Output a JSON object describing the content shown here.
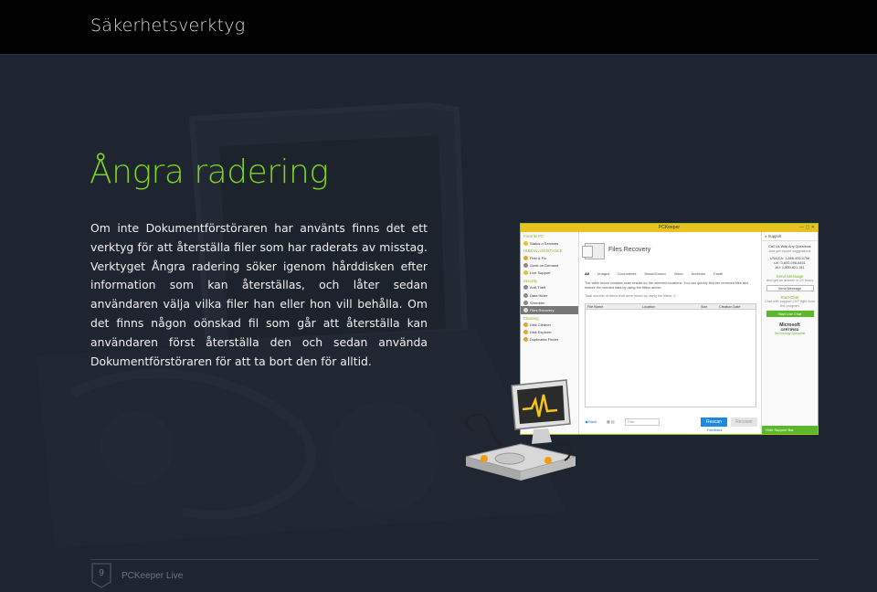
{
  "header": {
    "title": "Säkerhetsverktyg"
  },
  "content": {
    "heading": "Ångra radering",
    "paragraph": "Om inte Dokumentförstöraren har använts finns det ett verktyg för att återställa filer som har raderats av misstag. Verktyget Ångra radering söker igenom hårddisken efter information som kan återställas, och låter sedan användaren välja vilka filer han eller hon vill behålla. Om det finns någon oönskad fil som går att återställa kan användaren först återställa den och sedan använda Dokumentförstöraren för att ta bort den för alltid."
  },
  "screenshot": {
    "window_title": "PCKeeper",
    "left_panel": {
      "favorite": "Favorite PC",
      "status": "Status n Services",
      "human_section": "HUMAN ASSISTANCE",
      "items_human": [
        "Find & Fix",
        "Geek on Demand",
        "Live Support"
      ],
      "security_section": "Security",
      "items_security": [
        "Anti-Theft",
        "Data Hider",
        "Shredder",
        "Files Recovery"
      ],
      "cleaning_section": "Cleaning",
      "items_cleaning": [
        "Disk Cleaner",
        "Disk Explorer",
        "Duplicates Finder"
      ]
    },
    "main": {
      "title": "Files Recovery",
      "tabs": [
        "All",
        "Images",
        "Documents",
        "Music/Sound",
        "Video",
        "Archives",
        "Email"
      ],
      "description": "The table below contains scan results for the selected locations. You can quickly find the removed files and restore the needed data by using the filters above.",
      "count_label": "Total number of items that were found by using the filters:",
      "count_value": "0",
      "columns": [
        "File Name",
        "Location",
        "Size",
        "Creation Date"
      ],
      "back": "Back",
      "filter_placeholder": "Filter",
      "rescan": "Rescan",
      "recover": "Recover",
      "feedback": "Feedback"
    },
    "right_panel": {
      "support": "Support",
      "call": "Call Us With Any Questions",
      "call_sub": "And get expert suggestions",
      "phones": [
        "USA/CA: 1-866-400-4758",
        "UK: 0-800-098-8451",
        "AU: 1-800-821-311"
      ],
      "send_title": "Send Message",
      "send_sub": "And get an answer in 24 hours",
      "send_button": "Send Message",
      "chat_title": "Start Chat",
      "chat_sub": "Chat with support 24/7 right from the program",
      "chat_button": "Start Live Chat",
      "ms_line1": "Microsoft",
      "ms_line2": "CERTIFIED",
      "ms_line3": "Technology Specialist",
      "hide": "Hide Support Bar"
    }
  },
  "footer": {
    "page_number": "9",
    "brand": "PCKeeper Live"
  },
  "colors": {
    "accent_green": "#7ed321",
    "background": "#1f2530",
    "topbar": "#000000"
  }
}
